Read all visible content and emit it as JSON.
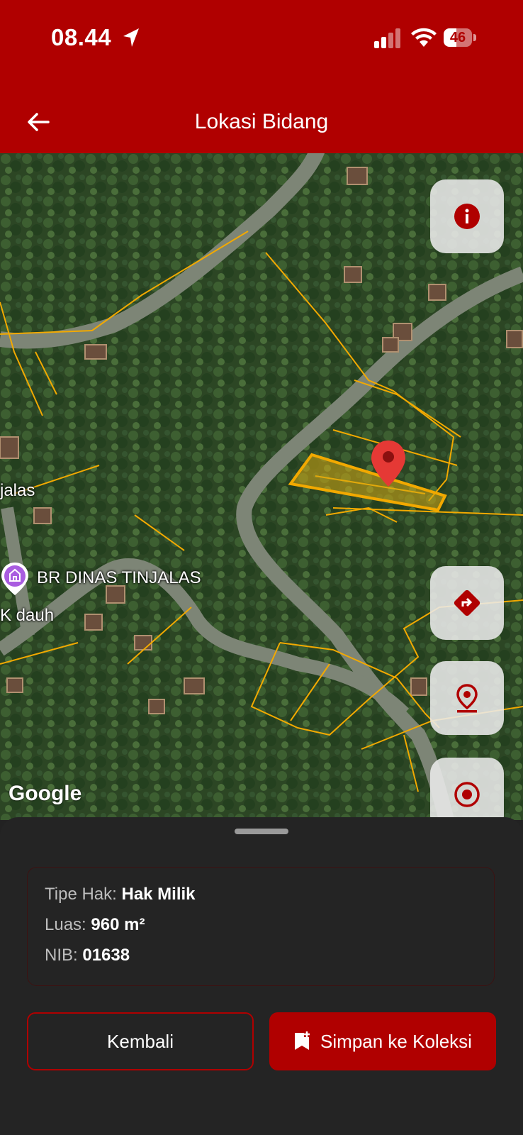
{
  "status_bar": {
    "time": "08.44",
    "battery": "46",
    "battery_level": 0.46
  },
  "header": {
    "title": "Lokasi Bidang"
  },
  "map": {
    "labels": {
      "village": "jalas",
      "poi": "BR DINAS TINJALAS",
      "poi2": "K dauh"
    },
    "attribution": "Google",
    "buttons": [
      "info-icon",
      "directions-icon",
      "location-pin-icon",
      "target-icon"
    ]
  },
  "details": {
    "tipe_hak_label": "Tipe Hak:",
    "tipe_hak_value": "Hak Milik",
    "luas_label": "Luas:",
    "luas_value": "960 m²",
    "nib_label": "NIB:",
    "nib_value": "01638"
  },
  "actions": {
    "back_label": "Kembali",
    "save_label": "Simpan ke Koleksi"
  },
  "colors": {
    "brand": "#b00000",
    "parcel_outline": "#f2a900",
    "sheet_bg": "#242424"
  }
}
